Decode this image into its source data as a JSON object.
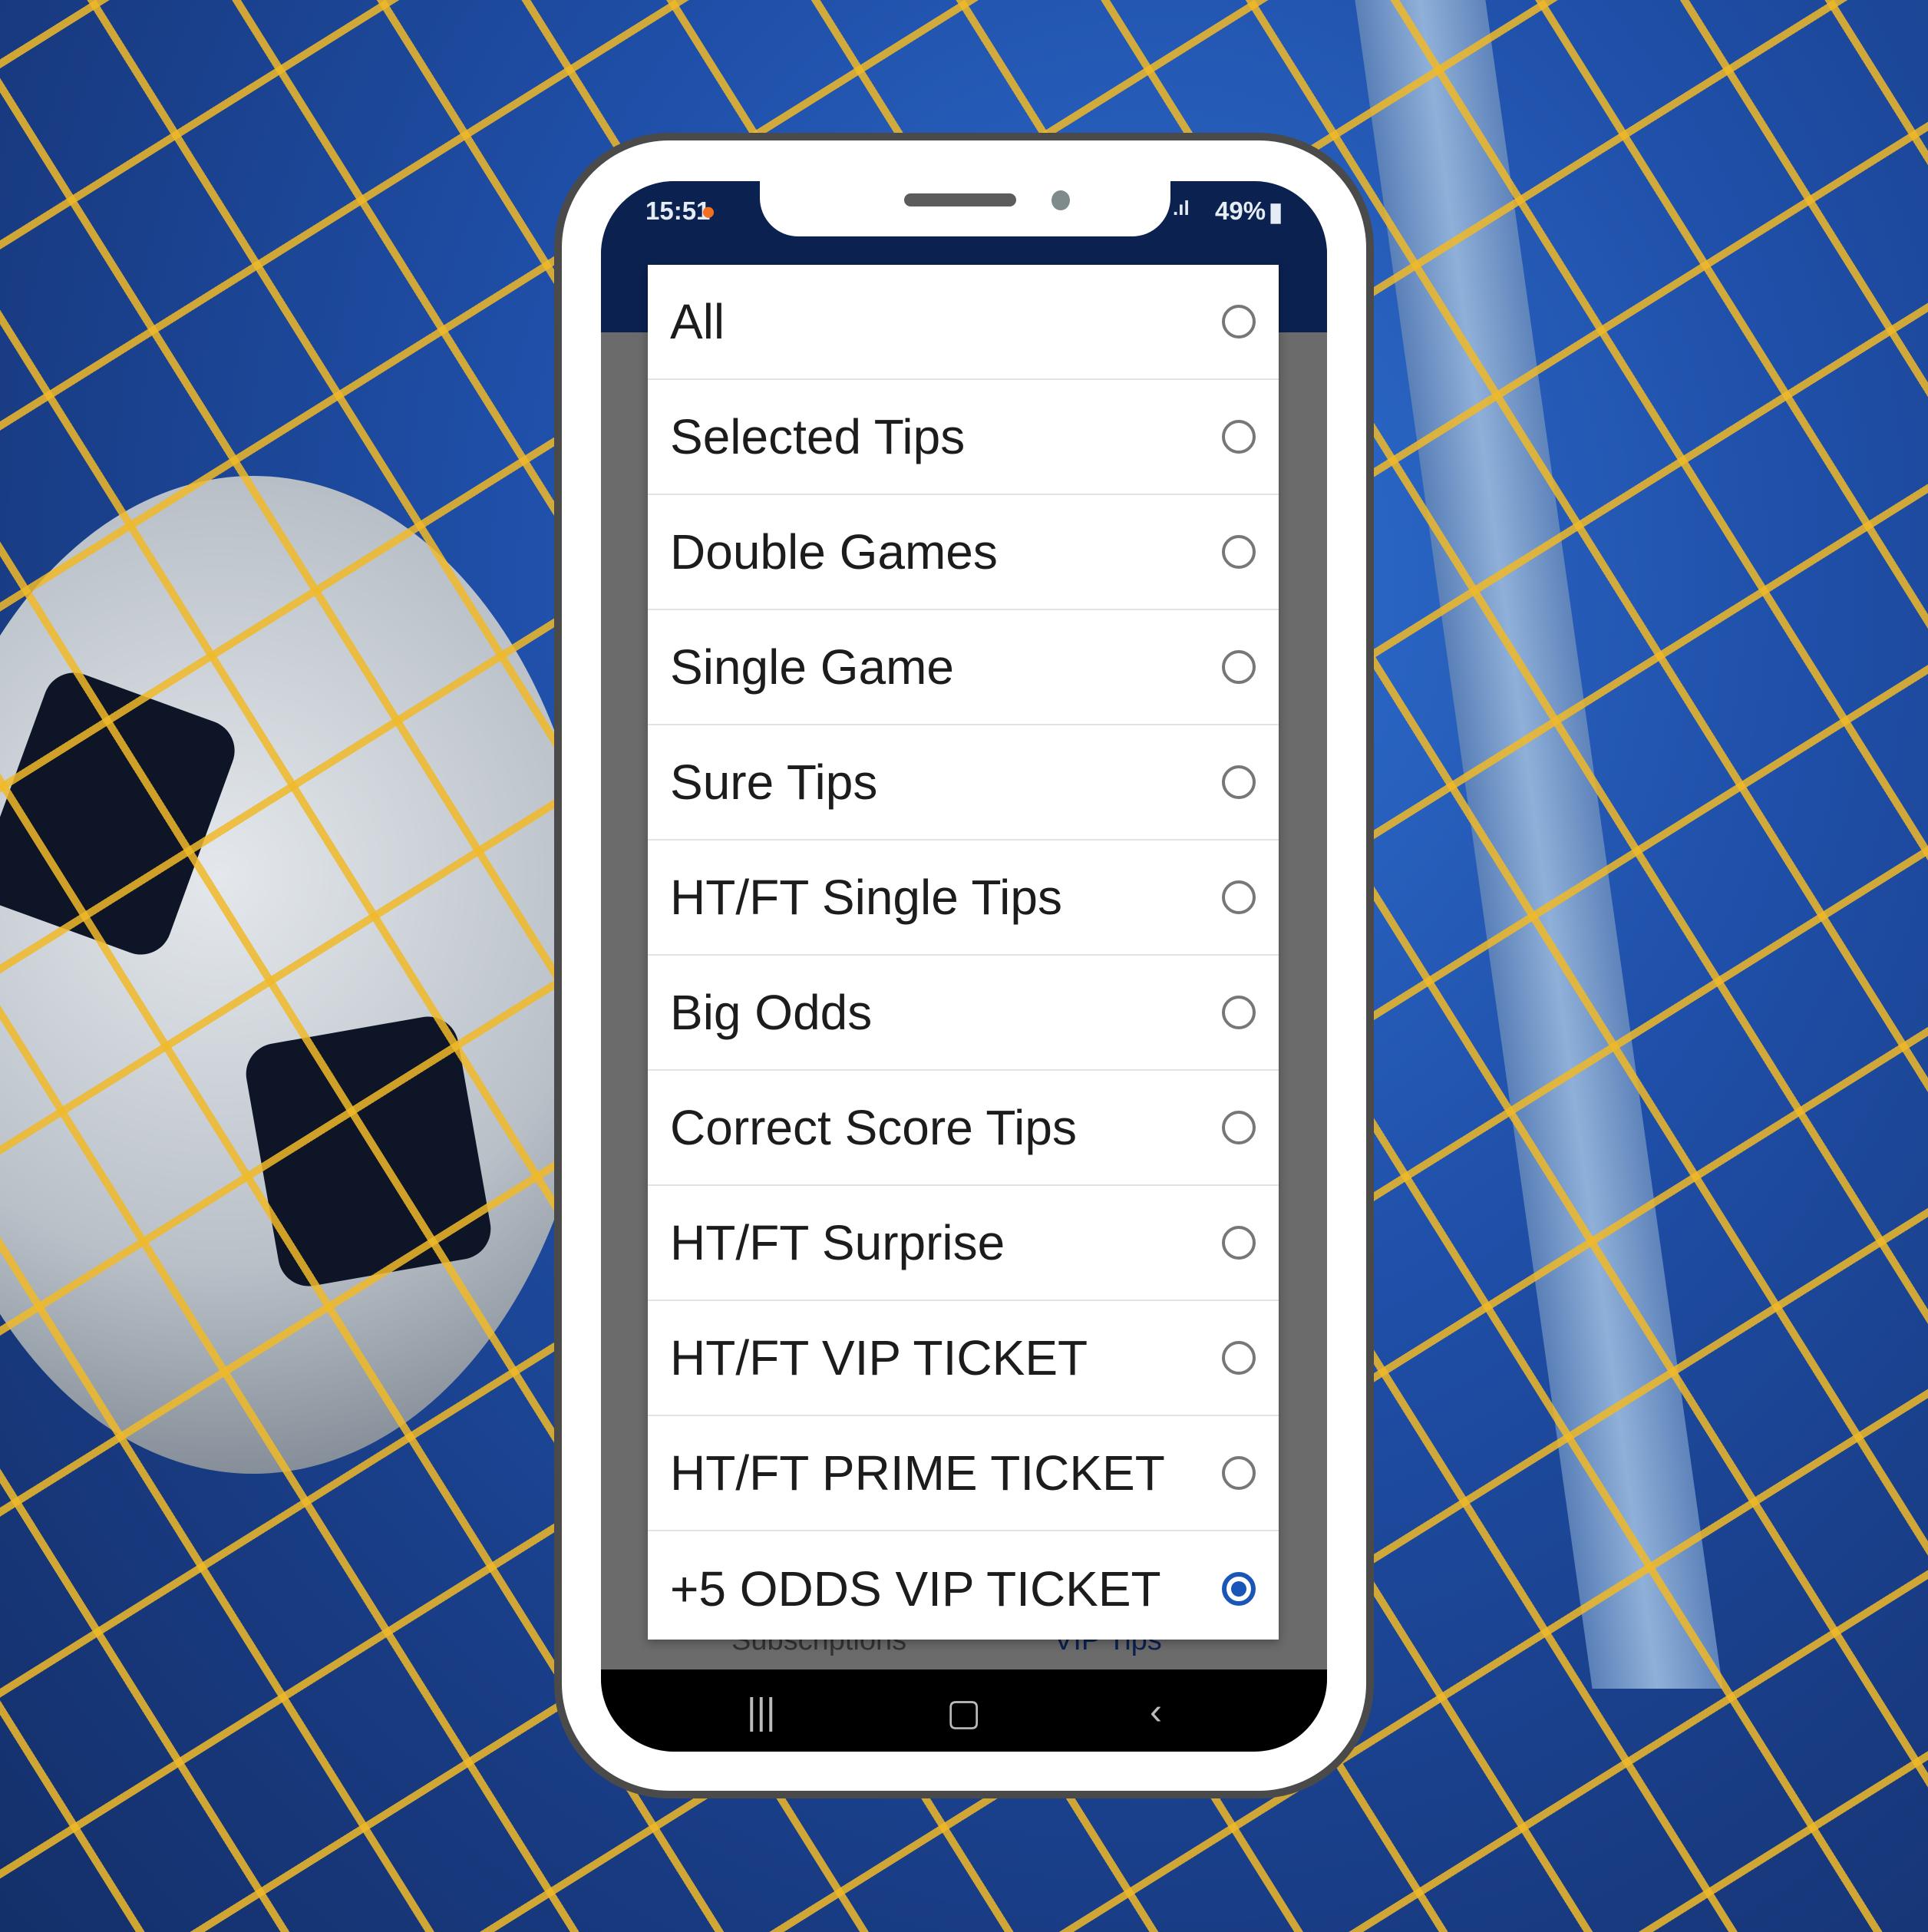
{
  "status_bar": {
    "time": "15:51",
    "battery": "49%",
    "signal_icon": "signal-bars-icon",
    "battery_icon": "battery-icon"
  },
  "background_tabs": [
    {
      "label": "Subscriptions"
    },
    {
      "label": "VIP Tips"
    }
  ],
  "filter_options": [
    {
      "label": "All",
      "selected": false
    },
    {
      "label": "Selected Tips",
      "selected": false
    },
    {
      "label": "Double Games",
      "selected": false
    },
    {
      "label": "Single Game",
      "selected": false
    },
    {
      "label": "Sure Tips",
      "selected": false
    },
    {
      "label": "HT/FT Single Tips",
      "selected": false
    },
    {
      "label": "Big Odds",
      "selected": false
    },
    {
      "label": "Correct Score Tips",
      "selected": false
    },
    {
      "label": "HT/FT Surprise",
      "selected": false
    },
    {
      "label": "HT/FT VIP TICKET",
      "selected": false
    },
    {
      "label": "HT/FT PRIME TICKET",
      "selected": false
    },
    {
      "label": "+5 ODDS VIP TICKET",
      "selected": true
    }
  ],
  "nav": {
    "recents": "recents-icon",
    "home": "home-icon",
    "back": "back-icon"
  },
  "colors": {
    "accent": "#1a56b8",
    "header": "#0b2150"
  }
}
